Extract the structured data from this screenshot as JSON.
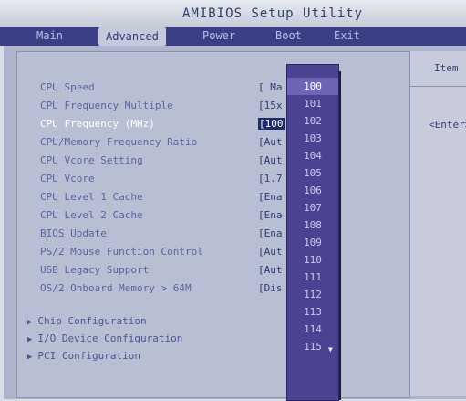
{
  "title": "AMIBIOS Setup Utility",
  "menu": {
    "items": [
      "Main",
      "Advanced",
      "Power",
      "Boot",
      "Exit"
    ],
    "active": "Advanced"
  },
  "settings": [
    {
      "label": "CPU Speed",
      "value": "[ Ma"
    },
    {
      "label": "CPU Frequency Multiple",
      "value": "[15x"
    },
    {
      "label": "CPU Frequency (MHz)",
      "value": "[100",
      "highlight": true
    },
    {
      "label": "CPU/Memory Frequency Ratio",
      "value": "[Aut"
    },
    {
      "label": "CPU Vcore Setting",
      "value": "[Aut"
    },
    {
      "label": "CPU Vcore",
      "value": "[1.7"
    },
    {
      "label": "CPU Level 1 Cache",
      "value": "[Ena"
    },
    {
      "label": "CPU Level 2 Cache",
      "value": "[Ena"
    },
    {
      "label": "BIOS Update",
      "value": "[Ena"
    },
    {
      "label": "PS/2 Mouse Function Control",
      "value": "[Aut"
    },
    {
      "label": "USB Legacy Support",
      "value": "[Aut"
    },
    {
      "label": "OS/2 Onboard Memory > 64M",
      "value": "[Dis"
    }
  ],
  "submenus": [
    "Chip Configuration",
    "I/O Device Configuration",
    "PCI Configuration"
  ],
  "popup": {
    "options": [
      "100",
      "101",
      "102",
      "103",
      "104",
      "105",
      "106",
      "107",
      "108",
      "109",
      "110",
      "111",
      "112",
      "113",
      "114",
      "115"
    ],
    "selected": "100"
  },
  "help_panel": {
    "header": "Item",
    "enter_text": "<Enter>"
  },
  "icons": {
    "submenu_arrow": "triangle-right-icon",
    "scroll_down": "triangle-down-icon"
  },
  "colors": {
    "menubar": "#3a3f86",
    "popup": "#4a4391",
    "highlight_text": "#ffffff"
  }
}
